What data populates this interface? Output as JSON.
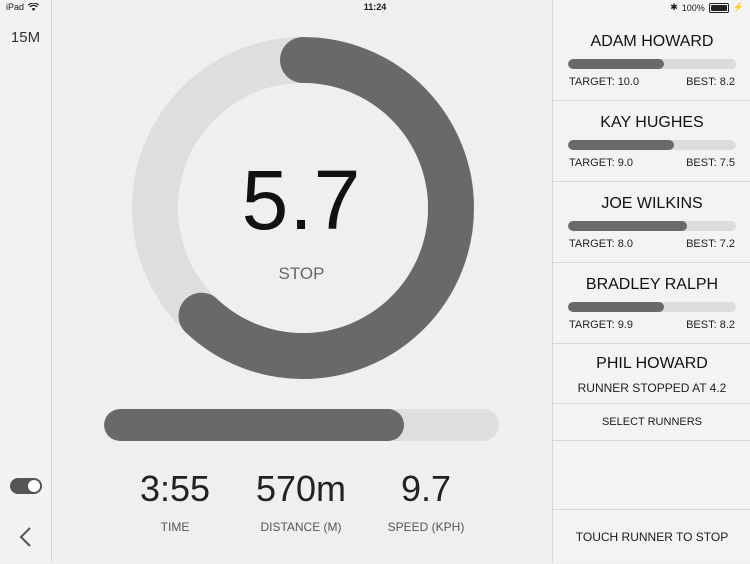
{
  "status_bar": {
    "device": "iPad",
    "time": "11:24",
    "battery": "100%"
  },
  "left_panel": {
    "interval": "15M",
    "toggle_on": true
  },
  "main": {
    "big_value": "5.7",
    "stop_label": "STOP",
    "ring_progress": 0.62,
    "progress_fill": 0.76,
    "stats": [
      {
        "value": "3:55",
        "label": "TIME"
      },
      {
        "value": "570m",
        "label": "DISTANCE (M)"
      },
      {
        "value": "9.7",
        "label": "SPEED (KPH)"
      }
    ]
  },
  "runners": [
    {
      "name": "ADAM HOWARD",
      "target": "TARGET: 10.0",
      "best": "BEST: 8.2",
      "progress": 0.57
    },
    {
      "name": "KAY HUGHES",
      "target": "TARGET: 9.0",
      "best": "BEST: 7.5",
      "progress": 0.63
    },
    {
      "name": "JOE WILKINS",
      "target": "TARGET: 8.0",
      "best": "BEST: 7.2",
      "progress": 0.71
    },
    {
      "name": "BRADLEY RALPH",
      "target": "TARGET: 9.9",
      "best": "BEST: 8.2",
      "progress": 0.57
    },
    {
      "name": "PHIL HOWARD",
      "stopped": "RUNNER STOPPED AT 4.2"
    }
  ],
  "select_runners": "SELECT RUNNERS",
  "touch_runner": "TOUCH RUNNER TO STOP",
  "colors": {
    "accent": "#696969",
    "track": "#dedede",
    "background": "#efefef"
  }
}
